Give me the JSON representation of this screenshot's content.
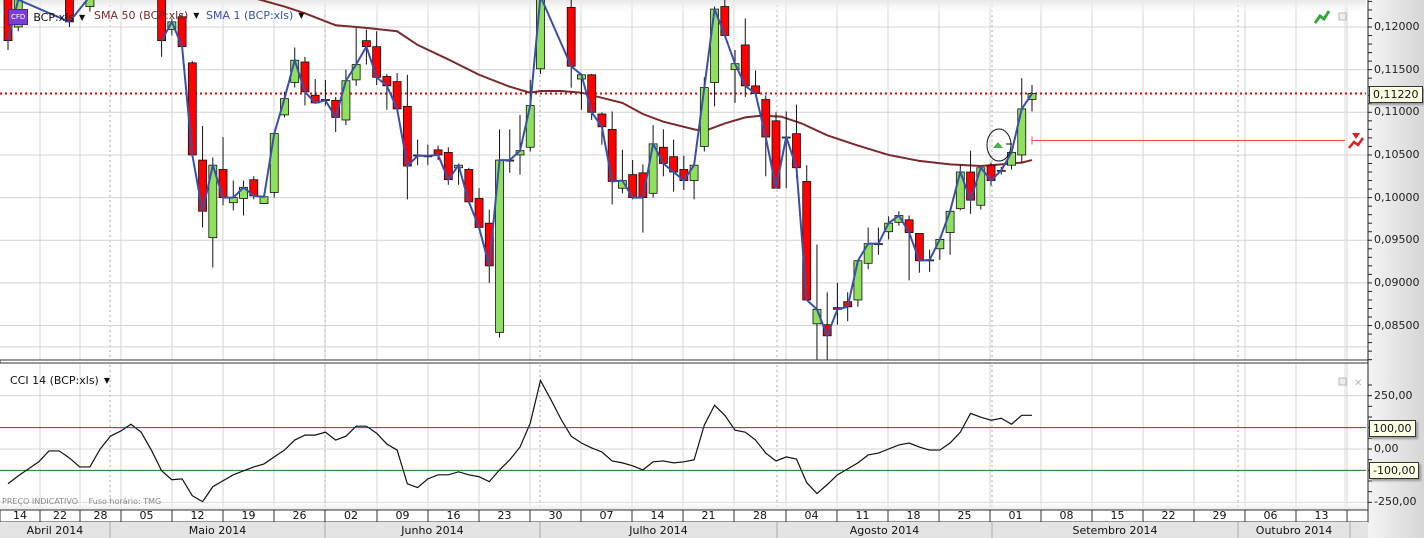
{
  "legend": {
    "symbol_badge": "CFD",
    "symbol": "BCP:xls",
    "sma50": "SMA 50 (BCP:xls)",
    "sma1": "SMA 1 (BCP:xls)",
    "cci": "CCI 14 (BCP:xls)"
  },
  "footer": {
    "price_note": "PREÇO INDICATIVO",
    "timezone": "Fuso horário: TMG"
  },
  "colors": {
    "up": "#8fe05e",
    "down": "#ff0000",
    "sma50": "#7a2a2a",
    "sma1": "#3a4fa8",
    "current_line": "#e00000",
    "cci_upper": "#ff0000",
    "cci_lower": "#1a7a1a"
  },
  "chart_data": [
    {
      "type": "candlestick",
      "title": "BCP:xls",
      "current_price_label": "0,11220",
      "ylim": [
        0.081,
        0.1232
      ],
      "yticks": [
        "0,12000",
        "0,11500",
        "0,11000",
        "0,10500",
        "0,10000",
        "0,09500",
        "0,09000",
        "0,08500"
      ],
      "ytick_values": [
        0.12,
        0.115,
        0.11,
        0.105,
        0.1,
        0.095,
        0.09,
        0.085
      ],
      "x_labels": [
        "14",
        "22",
        "28",
        "05",
        "12",
        "19",
        "26",
        "02",
        "09",
        "16",
        "23",
        "30",
        "07",
        "14",
        "21",
        "28",
        "04",
        "11",
        "18",
        "25",
        "01",
        "08",
        "15",
        "22",
        "29",
        "06",
        "13"
      ],
      "months": [
        "Abril 2014",
        "Maio 2014",
        "Junho 2014",
        "Julho 2014",
        "Agosto 2014",
        "Setembro 2014",
        "Outubro 2014"
      ],
      "candles_fields": [
        "day_index",
        "open",
        "high",
        "low",
        "close"
      ],
      "candles": [
        [
          0,
          0.1236,
          0.124,
          0.1173,
          0.1184
        ],
        [
          1,
          0.12,
          0.124,
          0.1195,
          0.1232
        ],
        [
          6,
          0.1236,
          0.124,
          0.12,
          0.1206
        ],
        [
          8,
          0.1224,
          0.124,
          0.1218,
          0.1236
        ],
        [
          15,
          0.1236,
          0.124,
          0.1165,
          0.1184
        ],
        [
          16,
          0.1197,
          0.121,
          0.119,
          0.1206
        ],
        [
          17,
          0.1212,
          0.1215,
          0.1173,
          0.1177
        ],
        [
          18,
          0.1158,
          0.116,
          0.105,
          0.105
        ],
        [
          19,
          0.1044,
          0.1084,
          0.0965,
          0.0984
        ],
        [
          20,
          0.0953,
          0.1047,
          0.0918,
          0.1038
        ],
        [
          21,
          0.1033,
          0.1071,
          0.0991,
          0.1
        ],
        [
          22,
          0.0994,
          0.102,
          0.0985,
          0.1
        ],
        [
          23,
          0.0999,
          0.102,
          0.0979,
          0.1012
        ],
        [
          24,
          0.1021,
          0.1025,
          0.0998,
          0.1002
        ],
        [
          25,
          0.0993,
          0.1001,
          0.0993,
          0.1001
        ],
        [
          26,
          0.1006,
          0.1077,
          0.1,
          0.1075
        ],
        [
          27,
          0.1097,
          0.1124,
          0.1094,
          0.1116
        ],
        [
          28,
          0.1135,
          0.1176,
          0.1129,
          0.1161
        ],
        [
          29,
          0.1159,
          0.1165,
          0.1108,
          0.1124
        ],
        [
          30,
          0.112,
          0.1139,
          0.111,
          0.1111
        ],
        [
          31,
          0.1115,
          0.1138,
          0.1108,
          0.1114
        ],
        [
          32,
          0.1114,
          0.1118,
          0.1077,
          0.1094
        ],
        [
          33,
          0.1091,
          0.115,
          0.1085,
          0.1137
        ],
        [
          34,
          0.1138,
          0.1199,
          0.1131,
          0.1156
        ],
        [
          35,
          0.1184,
          0.1197,
          0.1156,
          0.1177
        ],
        [
          36,
          0.1177,
          0.1195,
          0.1132,
          0.1141
        ],
        [
          37,
          0.1142,
          0.1145,
          0.1103,
          0.1131
        ],
        [
          38,
          0.1136,
          0.1146,
          0.1101,
          0.1104
        ],
        [
          39,
          0.1107,
          0.1144,
          0.0998,
          0.1037
        ],
        [
          40,
          0.105,
          0.1068,
          0.1038,
          0.1049
        ],
        [
          41,
          0.1049,
          0.1062,
          0.1038,
          0.1049
        ],
        [
          42,
          0.1056,
          0.1061,
          0.1044,
          0.105
        ],
        [
          43,
          0.1053,
          0.1059,
          0.1015,
          0.1021
        ],
        [
          44,
          0.1035,
          0.104,
          0.1015,
          0.1038
        ],
        [
          45,
          0.1033,
          0.1035,
          0.0994,
          0.0995
        ],
        [
          46,
          0.0999,
          0.1011,
          0.0965,
          0.0965
        ],
        [
          47,
          0.097,
          0.0986,
          0.09,
          0.092
        ],
        [
          48,
          0.0842,
          0.108,
          0.0836,
          0.1044
        ],
        [
          49,
          0.1044,
          0.108,
          0.1029,
          0.1044
        ],
        [
          50,
          0.105,
          0.1097,
          0.1027,
          0.1055
        ],
        [
          51,
          0.1059,
          0.1138,
          0.1054,
          0.1108
        ],
        [
          52,
          0.1151,
          0.124,
          0.1145,
          0.1236
        ],
        [
          55,
          0.1223,
          0.1236,
          0.1129,
          0.1154
        ],
        [
          56,
          0.1139,
          0.1145,
          0.1103,
          0.1144
        ],
        [
          57,
          0.1144,
          0.1145,
          0.1091,
          0.11
        ],
        [
          58,
          0.1098,
          0.11,
          0.1062,
          0.1083
        ],
        [
          59,
          0.108,
          0.1101,
          0.0992,
          0.1019
        ],
        [
          60,
          0.1011,
          0.1056,
          0.1005,
          0.102
        ],
        [
          61,
          0.1027,
          0.1044,
          0.0998,
          0.1
        ],
        [
          62,
          0.1029,
          0.1039,
          0.0959,
          0.1
        ],
        [
          63,
          0.1005,
          0.1085,
          0.1,
          0.1063
        ],
        [
          64,
          0.1059,
          0.108,
          0.1025,
          0.104
        ],
        [
          65,
          0.1048,
          0.1068,
          0.1007,
          0.103
        ],
        [
          66,
          0.1033,
          0.1049,
          0.1009,
          0.102
        ],
        [
          67,
          0.102,
          0.1039,
          0.0998,
          0.1038
        ],
        [
          68,
          0.106,
          0.1141,
          0.1054,
          0.1129
        ],
        [
          69,
          0.1135,
          0.1224,
          0.1107,
          0.1221
        ],
        [
          70,
          0.1224,
          0.1232,
          0.119,
          0.119
        ],
        [
          71,
          0.115,
          0.1173,
          0.1111,
          0.1157
        ],
        [
          72,
          0.1179,
          0.121,
          0.1118,
          0.1131
        ],
        [
          73,
          0.1131,
          0.1149,
          0.112,
          0.1122
        ],
        [
          74,
          0.1115,
          0.112,
          0.1025,
          0.1071
        ],
        [
          75,
          0.109,
          0.11,
          0.1011,
          0.1011
        ],
        [
          76,
          0.1071,
          0.1101,
          0.1011,
          0.1071
        ],
        [
          77,
          0.1075,
          0.1109,
          0.1023,
          0.1035
        ],
        [
          78,
          0.1019,
          0.1038,
          0.088,
          0.088
        ],
        [
          79,
          0.0852,
          0.0945,
          0.081,
          0.0869
        ],
        [
          80,
          0.0851,
          0.0889,
          0.081,
          0.0838
        ],
        [
          81,
          0.0871,
          0.09,
          0.0851,
          0.0869
        ],
        [
          82,
          0.0878,
          0.0889,
          0.0855,
          0.0872
        ],
        [
          83,
          0.088,
          0.0926,
          0.0872,
          0.0926
        ],
        [
          84,
          0.0923,
          0.0965,
          0.0916,
          0.0946
        ],
        [
          85,
          0.0945,
          0.0965,
          0.0933,
          0.0946
        ],
        [
          86,
          0.096,
          0.0978,
          0.0951,
          0.097
        ],
        [
          87,
          0.0971,
          0.0984,
          0.0967,
          0.0979
        ],
        [
          88,
          0.0974,
          0.0979,
          0.0903,
          0.0959
        ],
        [
          89,
          0.0958,
          0.0958,
          0.0912,
          0.0926
        ],
        [
          90,
          0.0927,
          0.0939,
          0.0913,
          0.0927
        ],
        [
          91,
          0.094,
          0.0951,
          0.0927,
          0.0951
        ],
        [
          92,
          0.0959,
          0.0984,
          0.0933,
          0.0984
        ],
        [
          93,
          0.0987,
          0.1038,
          0.0985,
          0.103
        ],
        [
          94,
          0.103,
          0.1055,
          0.0981,
          0.0997
        ],
        [
          95,
          0.0991,
          0.1035,
          0.0986,
          0.1035
        ],
        [
          96,
          0.1038,
          0.1041,
          0.1014,
          0.102
        ],
        [
          97,
          0.1032,
          0.1036,
          0.1027,
          0.1032
        ],
        [
          98,
          0.1038,
          0.104,
          0.1033,
          0.1053
        ],
        [
          99,
          0.105,
          0.114,
          0.1041,
          0.1104
        ],
        [
          100,
          0.1115,
          0.1132,
          0.1101,
          0.1122
        ]
      ],
      "sma50": [
        [
          24,
          0.1234
        ],
        [
          27,
          0.1224
        ],
        [
          29,
          0.1216
        ],
        [
          32,
          0.1202
        ],
        [
          35,
          0.1199
        ],
        [
          38,
          0.1195
        ],
        [
          40,
          0.1179
        ],
        [
          43,
          0.1162
        ],
        [
          46,
          0.1144
        ],
        [
          49,
          0.113
        ],
        [
          51,
          0.1123
        ],
        [
          52,
          0.1125
        ],
        [
          54,
          0.1125
        ],
        [
          56,
          0.1123
        ],
        [
          58,
          0.1117
        ],
        [
          60,
          0.1111
        ],
        [
          62,
          0.1098
        ],
        [
          64,
          0.1089
        ],
        [
          67,
          0.108
        ],
        [
          68,
          0.1078
        ],
        [
          70,
          0.1087
        ],
        [
          72,
          0.1094
        ],
        [
          73.5,
          0.1096
        ],
        [
          75.5,
          0.1095
        ],
        [
          77.5,
          0.1087
        ],
        [
          80,
          0.1073
        ],
        [
          83,
          0.1061
        ],
        [
          86,
          0.105
        ],
        [
          89,
          0.1043
        ],
        [
          92,
          0.1039
        ],
        [
          95,
          0.1037
        ],
        [
          97,
          0.1039
        ],
        [
          99,
          0.1041
        ],
        [
          100,
          0.1044
        ]
      ],
      "current_price": 0.1122,
      "alert_level": 0.1067
    },
    {
      "type": "line",
      "title": "CCI 14 (BCP:xls)",
      "ylim": [
        -300,
        330
      ],
      "yticks": [
        "250,00",
        "0,00",
        "-250,00"
      ],
      "ytick_values": [
        250,
        0,
        -250
      ],
      "levels": [
        {
          "value": 100,
          "label": "100,00"
        },
        {
          "value": -100,
          "label": "-100,00"
        }
      ],
      "values": [
        -163,
        -126,
        -93,
        -60,
        -9,
        -9,
        -42,
        -84,
        -84,
        0,
        60,
        84,
        116,
        79,
        -5,
        -102,
        -144,
        -140,
        -219,
        -247,
        -177,
        -149,
        -121,
        -102,
        -84,
        -70,
        -37,
        -5,
        42,
        65,
        65,
        79,
        42,
        60,
        107,
        107,
        74,
        23,
        -5,
        -163,
        -181,
        -140,
        -121,
        -121,
        -107,
        -121,
        -130,
        -153,
        -98,
        -51,
        9,
        121,
        321,
        233,
        140,
        60,
        28,
        5,
        -14,
        -56,
        -65,
        -79,
        -98,
        -60,
        -56,
        -65,
        -60,
        -51,
        112,
        205,
        158,
        88,
        79,
        42,
        -19,
        -56,
        -37,
        -47,
        -158,
        -209,
        -167,
        -121,
        -93,
        -65,
        -28,
        -19,
        0,
        19,
        28,
        9,
        -5,
        -5,
        28,
        79,
        167,
        149,
        135,
        144,
        116,
        158,
        158
      ]
    }
  ]
}
